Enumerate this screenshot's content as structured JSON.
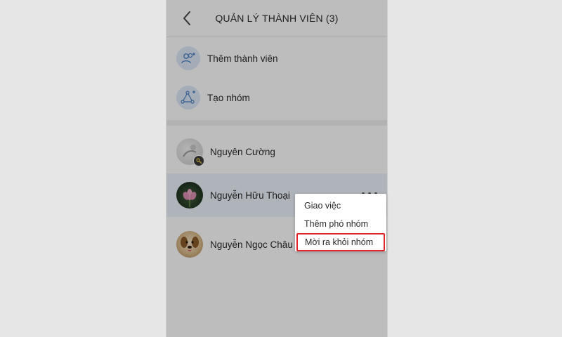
{
  "header": {
    "title": "QUẢN LÝ THÀNH VIÊN (3)",
    "back_icon": "chevron-left-icon"
  },
  "actions": [
    {
      "label": "Thêm thành viên",
      "icon": "add-users-icon"
    },
    {
      "label": "Tạo nhóm",
      "icon": "create-group-icon"
    }
  ],
  "members": [
    {
      "name": "Nguyên Cường",
      "badge_icon": "key-icon"
    },
    {
      "name": "Nguyễn Hữu Thoại",
      "more_icon": "more-dots-icon"
    },
    {
      "name": "Nguyễn Ngọc Châu"
    }
  ],
  "context_menu": {
    "items": [
      "Giao việc",
      "Thêm phó nhóm",
      "Mời ra khỏi nhóm"
    ],
    "highlight_color": "#e0232a"
  },
  "colors": {
    "accent_icon_bg": "#dce9f7",
    "accent_icon": "#4a7fc0",
    "active_row": "#edf3fb"
  }
}
